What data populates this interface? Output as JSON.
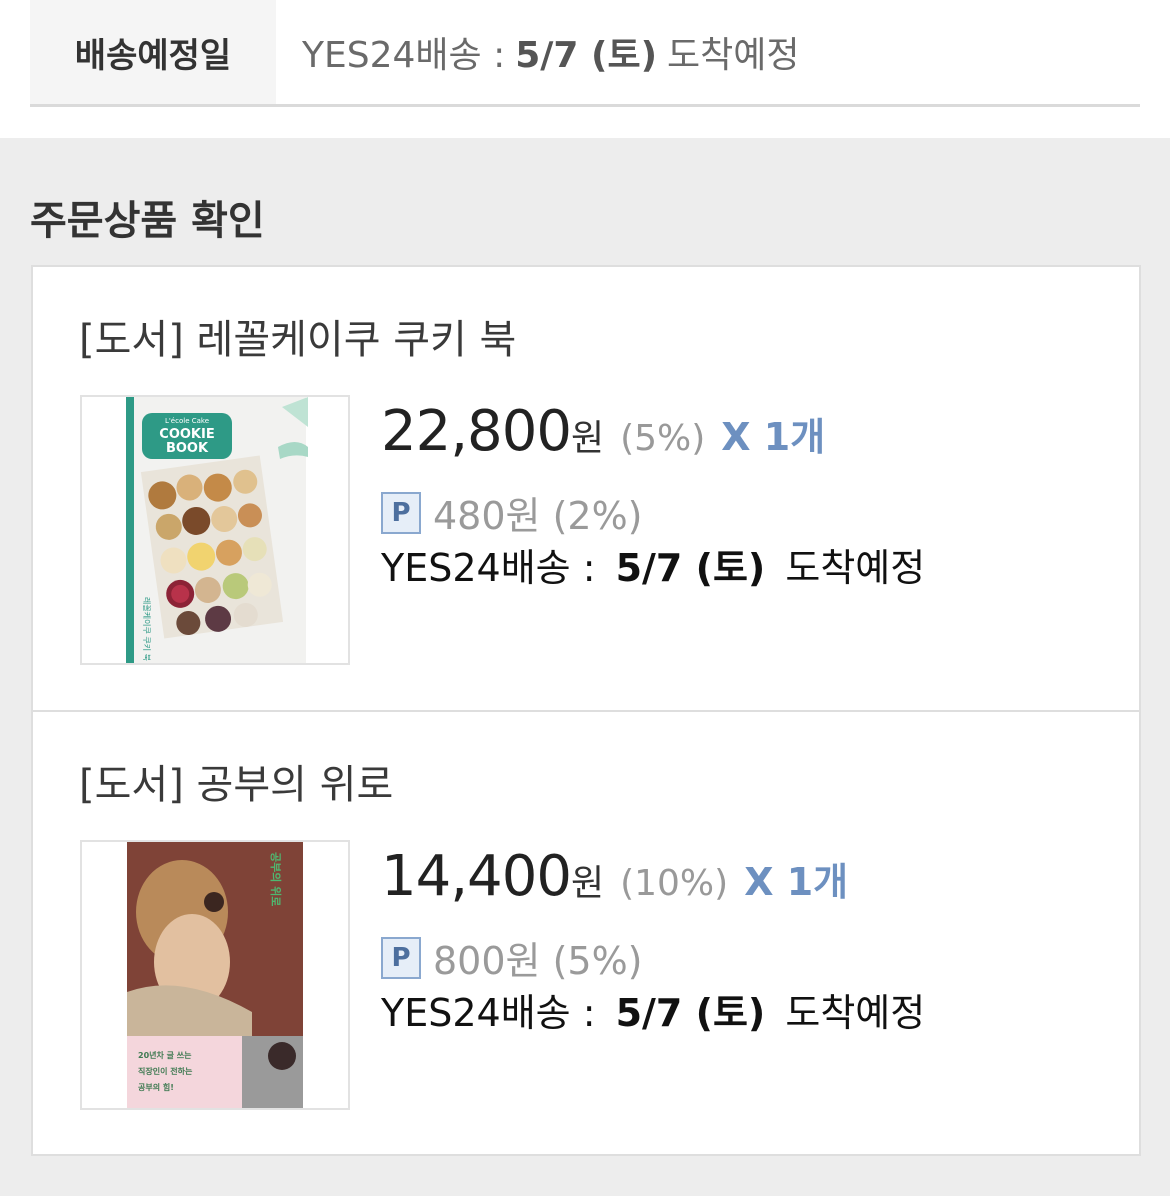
{
  "delivery": {
    "label": "배송예정일",
    "carrier": "YES24배송 :",
    "date": "5/7 (토)",
    "suffix": "도착예정"
  },
  "section_title": "주문상품 확인",
  "items": [
    {
      "title": "[도서] 레꼴케이쿠 쿠키 북",
      "price": "22,800",
      "currency": "원",
      "discount": "(5%)",
      "quantity": "X 1개",
      "points_badge": "P",
      "points": "480원 (2%)",
      "delivery_carrier": "YES24배송 :",
      "delivery_date": "5/7 (토)",
      "delivery_suffix": "도착예정",
      "cover": {
        "line1": "L'école Cake",
        "line2": "COOKIE",
        "line3": "BOOK",
        "spine": "레꼴케이쿠 쿠키 북",
        "accent": "#2e9a86"
      }
    },
    {
      "title": "[도서] 공부의 위로",
      "price": "14,400",
      "currency": "원",
      "discount": "(10%)",
      "quantity": "X 1개",
      "points_badge": "P",
      "points": "800원 (5%)",
      "delivery_carrier": "YES24배송 :",
      "delivery_date": "5/7 (토)",
      "delivery_suffix": "도착예정",
      "cover": {
        "vertical_title": "공부의 위로",
        "line1": "20년차 글 쓰는",
        "line2": "직장인이 전하는",
        "line3": "공부의 힘!",
        "accent": "#4fb870"
      }
    }
  ]
}
